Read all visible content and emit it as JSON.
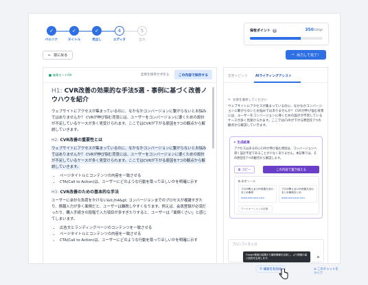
{
  "stepper": {
    "steps": [
      {
        "label": "ペルソナ",
        "state": "done",
        "mark": "✓"
      },
      {
        "label": "タイトル",
        "state": "done",
        "mark": "✓"
      },
      {
        "label": "見出し",
        "state": "done",
        "mark": "✓"
      },
      {
        "label": "エディタ",
        "state": "current",
        "mark": "4"
      },
      {
        "label": "出力",
        "state": "pending",
        "mark": "5"
      }
    ]
  },
  "points": {
    "title": "保有ポイント",
    "help_icon": "?",
    "value": "350",
    "max": "/500pt",
    "progress": 0.7
  },
  "actions": {
    "back_label": "前に戻る",
    "next_label": "出力して完了！"
  },
  "editor": {
    "mode_label": "編集モードON",
    "discard_label": "変更を保存せず戻る",
    "save_label": "この内容で保存する",
    "h1_tag": "H1:",
    "h1_text": "CVR改善の効果的な手法5選 - 事例に基づく改善ノウハウを紹介",
    "intro": "ウェブサイトにアクセスが集まっているのに、なかなかコンバージョンに繋がらないとお悩みではありませんか？ CVRが伸び悩む背景には、ユーザーをコンバージョンに導くための設計が不足しているケースが多く見受けられます。ここではCVRが下がる原因を7つの観点から解説していきます。",
    "h2_tag": "H2:",
    "h2_text": "CVR改善の重要性とは",
    "highlight": "ウェブサイトにアクセスが集まっているのに、なかなかコンバージョンに繋がらないとお悩みではありませんか？ CVRが伸び悩む背景には、ユーザーをコンバージョンに導くための設計が不足しているケースが多く見受けられます。ここではCVRが下がる原因を7つの観点から解説していきます。",
    "bullets1": [
      "ページタイトルとコンテンツの内容を一致させる",
      "CTA(Call to Action)は、ユーザーにどのような行動を取ってほしいかを明確に示す"
    ],
    "h3_tag": "H3:",
    "h3_text": "CVR改善のための基本的な手法",
    "para3": "ユーザーに余計な負荷をかけない&lt;/h4&gt; コンバージョンまでのプロセスが複雑すぎたり、情報入力が多く面倒だと、ユーザーは離脱しやすくなります。例えば、会員登録が必須だったり、購入手続きの段階で入力項目が多すぎたりすると、ユーザーは「面倒くさい」と感じてしまいます。",
    "bullets2": [
      "広告文とランディングページのコンテンツを一致させる",
      "ページタイトルとコンテンツの内容を一致させる",
      "CTA(Call to Action)は、ユーザーにどのような行動を取ってほしいかを明確に示す"
    ]
  },
  "panel": {
    "tabs": [
      "変更トピック",
      "AIライティングアシスト"
    ],
    "active_tab": 1,
    "user_edit_label": "文章を書析してください",
    "user_msg": "ウェブサイトにアクセスが集まっているのに、なかなかコンバージョンに繋がらないとお悩みではありませんか？ CVRが伸び悩む背景には、ユーザーをコンバージョンに導くための設計が不足しているケースが多く見受けられます。ここではCVRが下がる原因を7つの観点から解説していきます。",
    "gen_title": "生成結果",
    "gen_text": "アクセスはあるのにCVRが伸び悩む原因は、コンバージョンへ導く設計不足であることが少なくありません。本記事では、その原因を7つの観点から解説します。",
    "copy_label": "コピー",
    "insert_label": "この内容で置き換える",
    "ref_title": "参考ソース",
    "refs": [
      {
        "title": "プロが教えるCVR改善方法のまとめ事例",
        "url": "www.mercoce.com"
      },
      {
        "title": "プロが教えるCVR改善方法のまとめ事例まとめ",
        "url": "www.mercoce.com"
      }
    ],
    "ref_more": "ワードオーシャンの記事",
    "prompt_placeholder": "プロンプトを入力",
    "tooltip": "Google検索の結果から最新情報を活用し、より精度の高い回答を生成します。",
    "web_label": "検索を有効化",
    "clear_label": "このチャットをクリア"
  }
}
